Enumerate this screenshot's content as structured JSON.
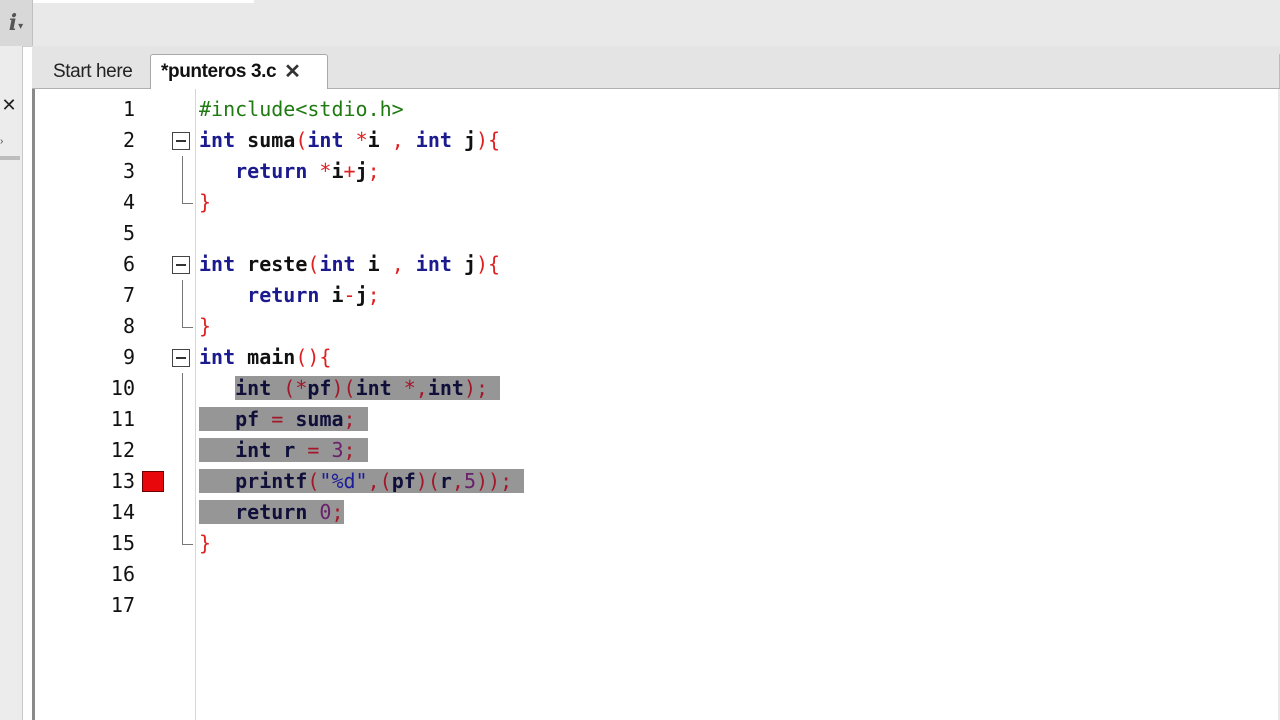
{
  "toolbar": {
    "icon_glyph": "i",
    "icon_suffix": "▾"
  },
  "left_panel": {
    "close_glyph": "✕",
    "expand_glyph": "›"
  },
  "tabs": [
    {
      "label": "Start here",
      "active": false
    },
    {
      "label": "*punteros 3.c",
      "active": true,
      "close_glyph": "✕"
    }
  ],
  "editor": {
    "breakpoint_line": 13,
    "selection_lines": [
      10,
      14
    ],
    "lines": [
      {
        "n": "1",
        "text": "#include<stdio.h>"
      },
      {
        "n": "2",
        "text": "int suma(int *i , int j){"
      },
      {
        "n": "3",
        "text": "return *i+j;"
      },
      {
        "n": "4",
        "text": "}"
      },
      {
        "n": "5",
        "text": ""
      },
      {
        "n": "6",
        "text": "int reste(int i , int j){"
      },
      {
        "n": "7",
        "text": "return i-j;"
      },
      {
        "n": "8",
        "text": "}"
      },
      {
        "n": "9",
        "text": "int main(){"
      },
      {
        "n": "10",
        "text": "int (*pf)(int *,int);"
      },
      {
        "n": "11",
        "text": "pf = suma;"
      },
      {
        "n": "12",
        "text": "int r = 3;"
      },
      {
        "n": "13",
        "text": "printf(\"%d\",(pf)(r,5));"
      },
      {
        "n": "14",
        "text": "return 0;"
      },
      {
        "n": "15",
        "text": "}"
      },
      {
        "n": "16",
        "text": ""
      },
      {
        "n": "17",
        "text": ""
      }
    ]
  },
  "colors": {
    "keyword": "#1b1b8f",
    "preprocessor": "#1f7a12",
    "operator": "#e02020",
    "number": "#b000c0",
    "selection": "#969696",
    "breakpoint": "#e8070a"
  }
}
